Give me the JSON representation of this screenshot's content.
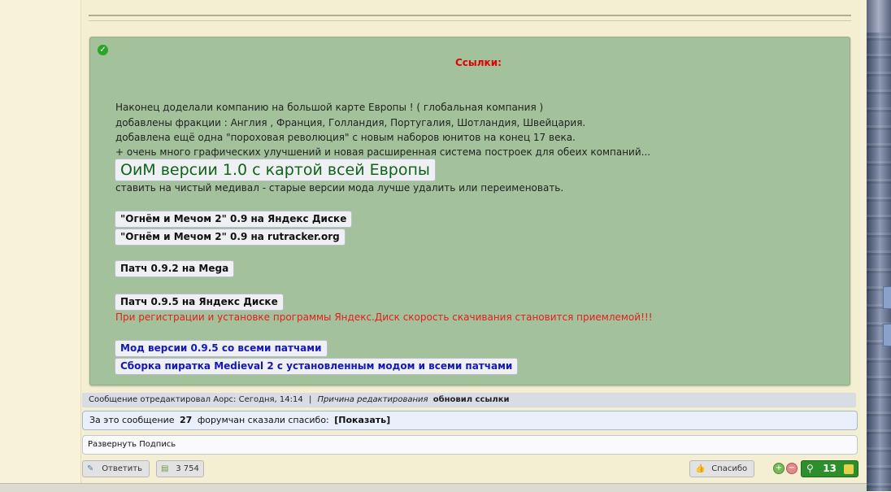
{
  "spoiler": {
    "title": "Ссылки:",
    "description_lines": [
      "Наконец доделали компанию на большой карте Европы ! ( глобальная компания )",
      "добавлены фракции : Англия , Франция, Голландия, Португалия, Шотландия, Швейцария.",
      "добавлена ещё одна \"пороховая революция\" с новым наборов юнитов на конец 17 века.",
      "+ очень много графических улучшений и новая расширенная система построек для обеих компаний..."
    ],
    "main_link": "ОиМ версии 1.0 с картой всей Европы",
    "install_note": "ставить на чистый медивал - старые версии мода лучше удалить или переименовать.",
    "link_yandex_09": "\"Огнём и Мечом 2\" 0.9 на Яндекс Диске",
    "link_rutracker_09": "\"Огнём и Мечом 2\" 0.9 на rutracker.org",
    "link_patch_092": "Патч 0.9.2 на Mega",
    "link_patch_095": "Патч 0.9.5 на Яндекс Диске",
    "warning": "При регистрации и установке программы Яндекс.Диск скорость скачивания становится приемлемой!!!",
    "link_mod_095": "Мод версии 0.9.5 со всеми патчами",
    "link_pirate": "Сборка пиратка Medieval 2 с установленным модом и всеми патчами"
  },
  "edit_info": {
    "prefix": "Сообщение отредактировал Аорс: Сегодня, 14:14",
    "separator": "|",
    "reason_label": "Причина редактирования",
    "reason": "обновил ссылки"
  },
  "thanks": {
    "prefix": "За это сообщение",
    "count": "27",
    "middle": "форумчан сказали спасибо:",
    "show": "[Показать]"
  },
  "signature": {
    "label": "Развернуть Подпись"
  },
  "actions": {
    "reply": "Ответить",
    "post_count": "3 754",
    "thanks": "Спасибо",
    "rating": "13"
  },
  "colors": {
    "spoiler_bg": "#a3c29c",
    "warning": "#e41d1d",
    "rating_bg": "#2c8f2c"
  }
}
